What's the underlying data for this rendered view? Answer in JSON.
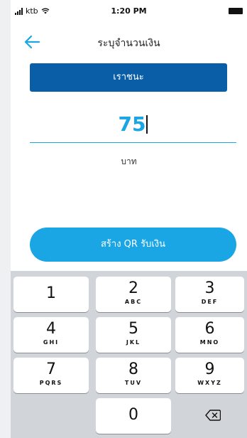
{
  "status_bar": {
    "carrier": "ktb",
    "time": "1:20 PM"
  },
  "nav": {
    "title": "ระบุจำนวนเงิน",
    "back_icon": "arrow-left-icon"
  },
  "account": {
    "name": "เราชนะ"
  },
  "amount": {
    "value": "75",
    "currency": "บาท"
  },
  "action": {
    "label": "สร้าง QR รับเงิน"
  },
  "keypad": {
    "keys": [
      {
        "num": "1",
        "letters": ""
      },
      {
        "num": "2",
        "letters": "ABC"
      },
      {
        "num": "3",
        "letters": "DEF"
      },
      {
        "num": "4",
        "letters": "GHI"
      },
      {
        "num": "5",
        "letters": "JKL"
      },
      {
        "num": "6",
        "letters": "MNO"
      },
      {
        "num": "7",
        "letters": "PQRS"
      },
      {
        "num": "8",
        "letters": "TUV"
      },
      {
        "num": "9",
        "letters": "WXYZ"
      },
      {
        "num": "0",
        "letters": ""
      }
    ],
    "delete_icon": "backspace-icon"
  },
  "colors": {
    "accent": "#1aa5e4",
    "banner": "#0a5ea8",
    "keypad_bg": "#d1d4d9"
  }
}
